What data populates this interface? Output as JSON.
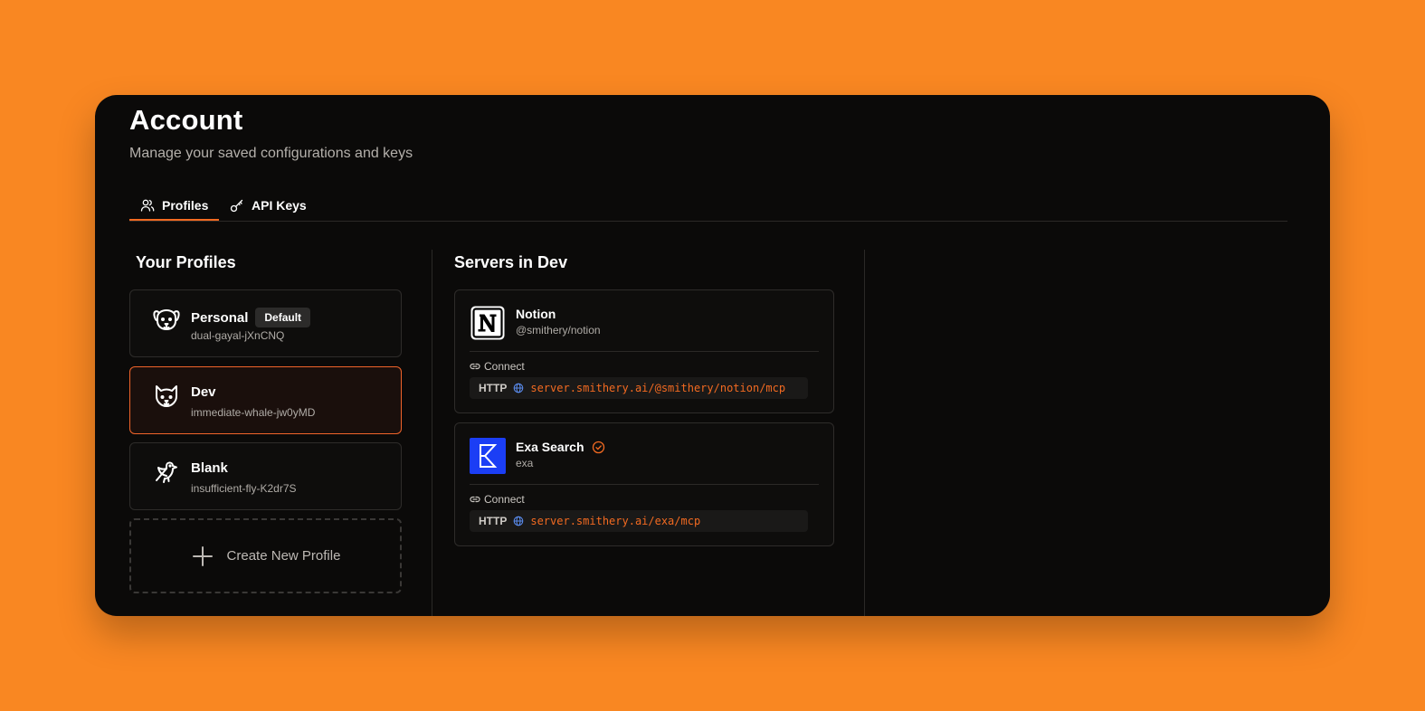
{
  "page": {
    "title": "Account",
    "subtitle": "Manage your saved configurations and keys"
  },
  "tabs": [
    {
      "label": "Profiles",
      "icon": "users-icon",
      "active": true
    },
    {
      "label": "API Keys",
      "icon": "key-icon",
      "active": false
    }
  ],
  "profiles_section": {
    "title": "Your Profiles",
    "items": [
      {
        "name": "Personal",
        "badge": "Default",
        "id": "dual-gayal-jXnCNQ",
        "icon": "dog-face-icon",
        "selected": false
      },
      {
        "name": "Dev",
        "id": "immediate-whale-jw0yMD",
        "icon": "cat-face-icon",
        "selected": true
      },
      {
        "name": "Blank",
        "id": "insufficient-fly-K2dr7S",
        "icon": "bird-icon",
        "selected": false
      }
    ],
    "create_label": "Create New Profile"
  },
  "servers_section": {
    "title": "Servers in Dev",
    "items": [
      {
        "name": "Notion",
        "handle": "@smithery/notion",
        "verified": false,
        "logo": "notion-logo",
        "connect_label": "Connect",
        "protocol": "HTTP",
        "url": "server.smithery.ai/@smithery/notion/mcp"
      },
      {
        "name": "Exa Search",
        "handle": "exa",
        "verified": true,
        "logo": "exa-logo",
        "connect_label": "Connect",
        "protocol": "HTTP",
        "url": "server.smithery.ai/exa/mcp"
      }
    ]
  },
  "colors": {
    "background": "#f98722",
    "card": "#0b0a09",
    "accent": "#f26a21",
    "exa_brand": "#1b3ef5"
  }
}
